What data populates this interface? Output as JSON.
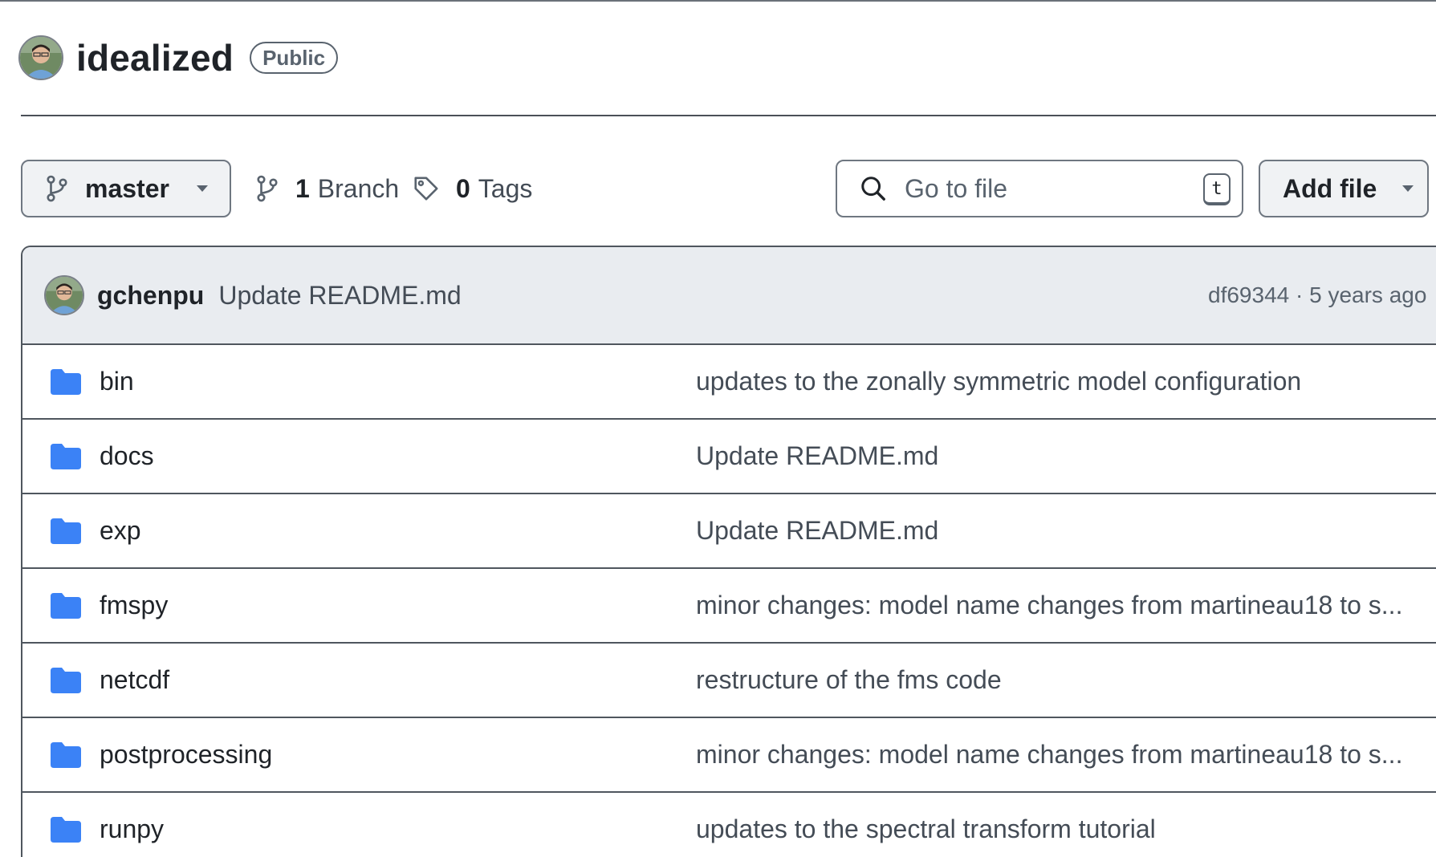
{
  "repo": {
    "name": "idealized",
    "visibility": "Public"
  },
  "toolbar": {
    "branch": "master",
    "branches_count": "1",
    "branches_label": "Branch",
    "tags_count": "0",
    "tags_label": "Tags",
    "search_placeholder": "Go to file",
    "search_shortcut": "t",
    "add_file_label": "Add file"
  },
  "latest_commit": {
    "author": "gchenpu",
    "message": "Update README.md",
    "meta": "df69344 · 5 years ago"
  },
  "files": [
    {
      "name": "bin",
      "type": "folder",
      "message": "updates to the zonally symmetric model configuration"
    },
    {
      "name": "docs",
      "type": "folder",
      "message": "Update README.md"
    },
    {
      "name": "exp",
      "type": "folder",
      "message": "Update README.md"
    },
    {
      "name": "fmspy",
      "type": "folder",
      "message": "minor changes: model name changes from martineau18 to s..."
    },
    {
      "name": "netcdf",
      "type": "folder",
      "message": "restructure of the fms code"
    },
    {
      "name": "postprocessing",
      "type": "folder",
      "message": "minor changes: model name changes from martineau18 to s..."
    },
    {
      "name": "runpy",
      "type": "folder",
      "message": "updates to the spectral transform tutorial"
    }
  ],
  "colors": {
    "folder": "#3b82f6",
    "commit_bar_bg": "#e9ecf0",
    "button_bg": "#f0f2f4"
  },
  "icons": {
    "branch": "git-branch-icon",
    "tag": "tag-icon",
    "search": "search-icon",
    "caret": "triangle-down-icon",
    "folder": "folder-icon",
    "avatar": "user-avatar"
  }
}
